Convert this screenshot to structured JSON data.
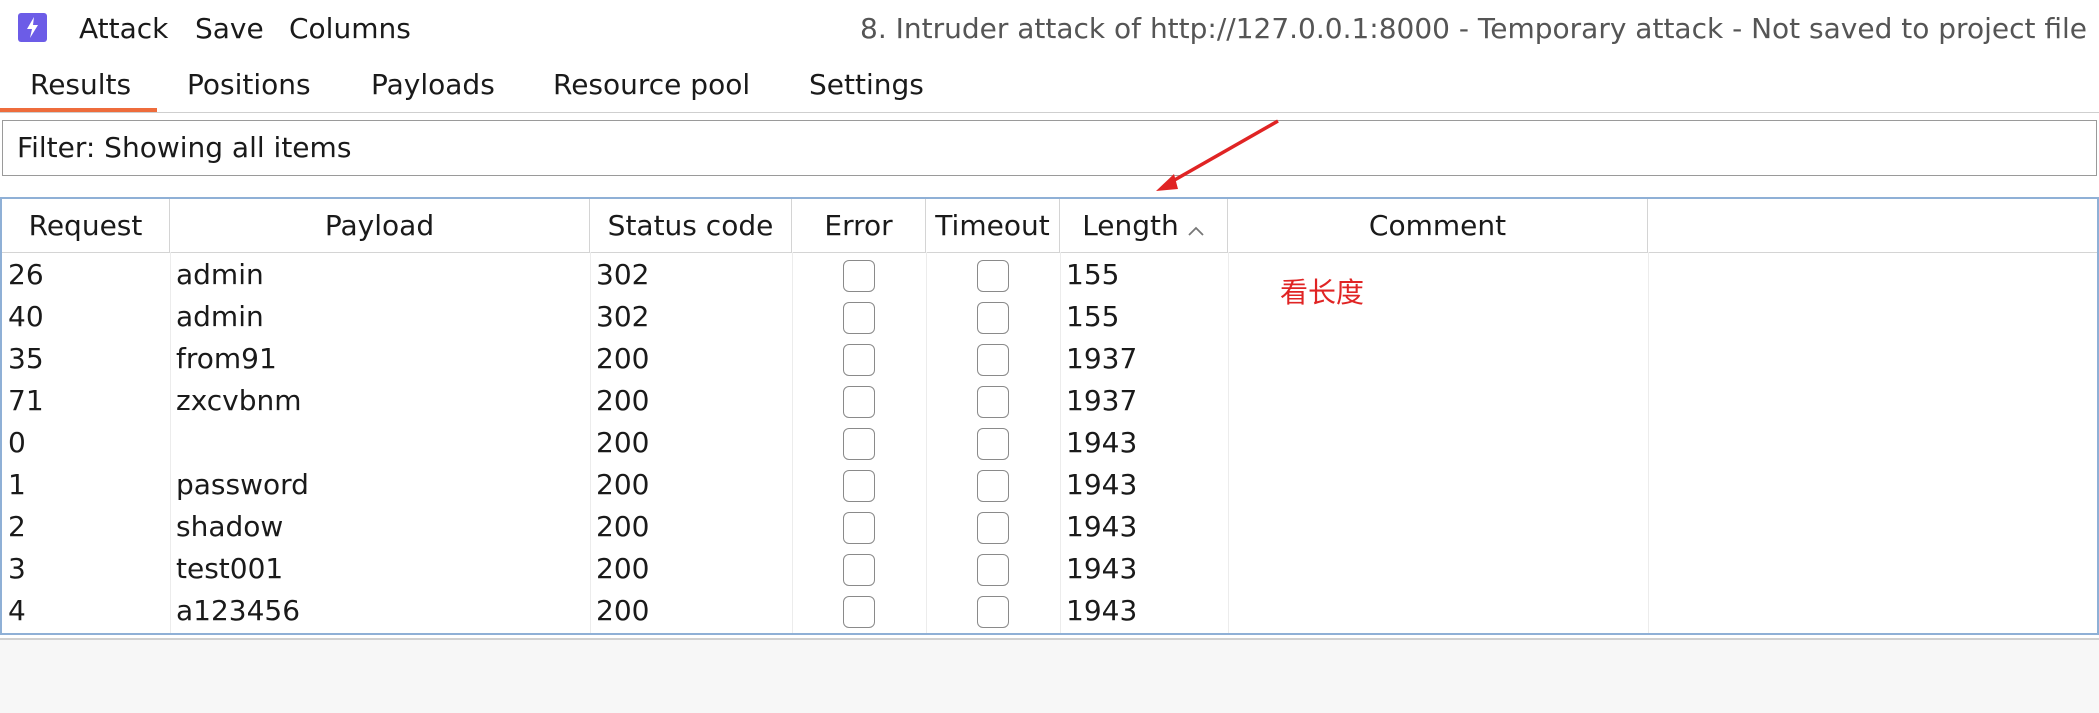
{
  "menubar": {
    "items": [
      "Attack",
      "Save",
      "Columns"
    ],
    "window_title": "8. Intruder attack of http://127.0.0.1:8000 - Temporary attack - Not saved to project file"
  },
  "tabs": [
    {
      "label": "Results",
      "active": true
    },
    {
      "label": "Positions"
    },
    {
      "label": "Payloads"
    },
    {
      "label": "Resource pool"
    },
    {
      "label": "Settings"
    }
  ],
  "filter": {
    "text": "Filter: Showing all items"
  },
  "table": {
    "columns": [
      "Request",
      "Payload",
      "Status code",
      "Error",
      "Timeout",
      "Length",
      "Comment"
    ],
    "sorted_column": "Length",
    "sort_direction": "ascending",
    "rows": [
      {
        "request": "26",
        "payload": "admin",
        "status": "302",
        "error": false,
        "timeout": false,
        "length": "155"
      },
      {
        "request": "40",
        "payload": "admin",
        "status": "302",
        "error": false,
        "timeout": false,
        "length": "155"
      },
      {
        "request": "35",
        "payload": "from91",
        "status": "200",
        "error": false,
        "timeout": false,
        "length": "1937"
      },
      {
        "request": "71",
        "payload": "zxcvbnm",
        "status": "200",
        "error": false,
        "timeout": false,
        "length": "1937"
      },
      {
        "request": "0",
        "payload": "",
        "status": "200",
        "error": false,
        "timeout": false,
        "length": "1943"
      },
      {
        "request": "1",
        "payload": "password",
        "status": "200",
        "error": false,
        "timeout": false,
        "length": "1943"
      },
      {
        "request": "2",
        "payload": "shadow",
        "status": "200",
        "error": false,
        "timeout": false,
        "length": "1943"
      },
      {
        "request": "3",
        "payload": "test001",
        "status": "200",
        "error": false,
        "timeout": false,
        "length": "1943"
      },
      {
        "request": "4",
        "payload": "a123456",
        "status": "200",
        "error": false,
        "timeout": false,
        "length": "1943"
      }
    ]
  },
  "annotation": {
    "text": "看长度",
    "color": "#e02424"
  },
  "colors": {
    "accent": "#ee6c3c",
    "app_icon": "#6c5ce7",
    "table_border": "#8fb0d6"
  }
}
